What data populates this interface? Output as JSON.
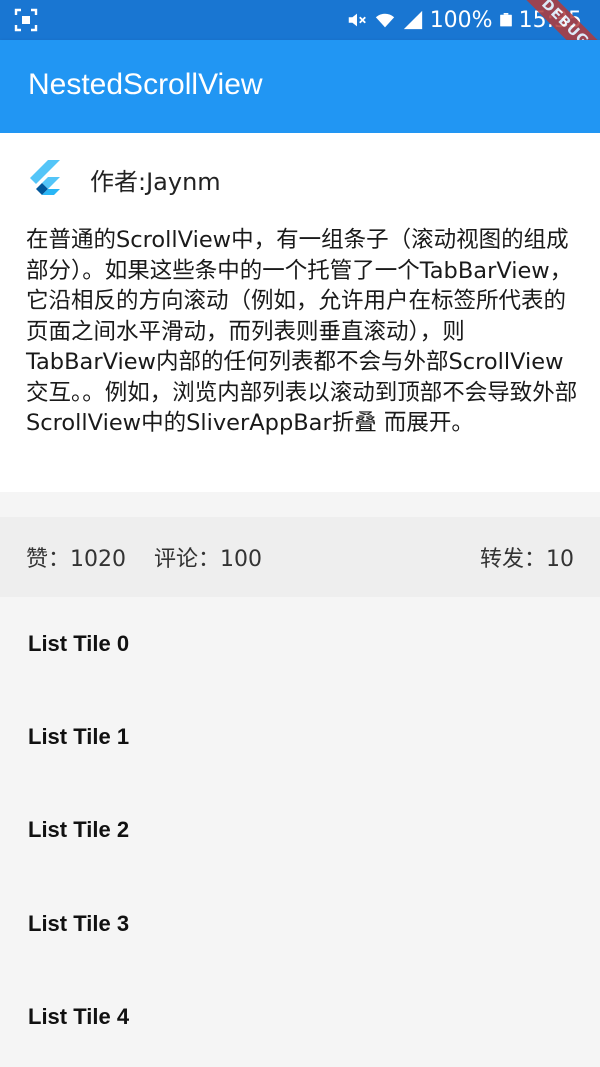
{
  "status_bar": {
    "battery_text": "100%",
    "time": "15:35"
  },
  "debug_banner": "DEBUG",
  "appbar": {
    "title": "NestedScrollView"
  },
  "header": {
    "author": "作者:Jaynm",
    "description": "在普通的ScrollView中，有一组条子（滚动视图的组成部分）。如果这些条中的一个托管了一个TabBarView，它沿相反的方向滚动（例如，允许用户在标签所代表的页面之间水平滑动，而列表则垂直滚动），则TabBarView内部的任何列表都不会与外部ScrollView交互。。例如，浏览内部列表以滚动到顶部不会导致外部ScrollView中的SliverAppBar折叠 而展开。"
  },
  "stats": {
    "likes": "赞：1020",
    "comments": "评论：100",
    "shares": "转发：10"
  },
  "list_tiles": [
    "List Tile 0",
    "List Tile 1",
    "List Tile 2",
    "List Tile 3",
    "List Tile 4"
  ],
  "colors": {
    "status_bar": "#1976d2",
    "appbar": "#2196f3",
    "stats_bg": "#eeeeee",
    "page_bg": "#f5f5f5"
  }
}
